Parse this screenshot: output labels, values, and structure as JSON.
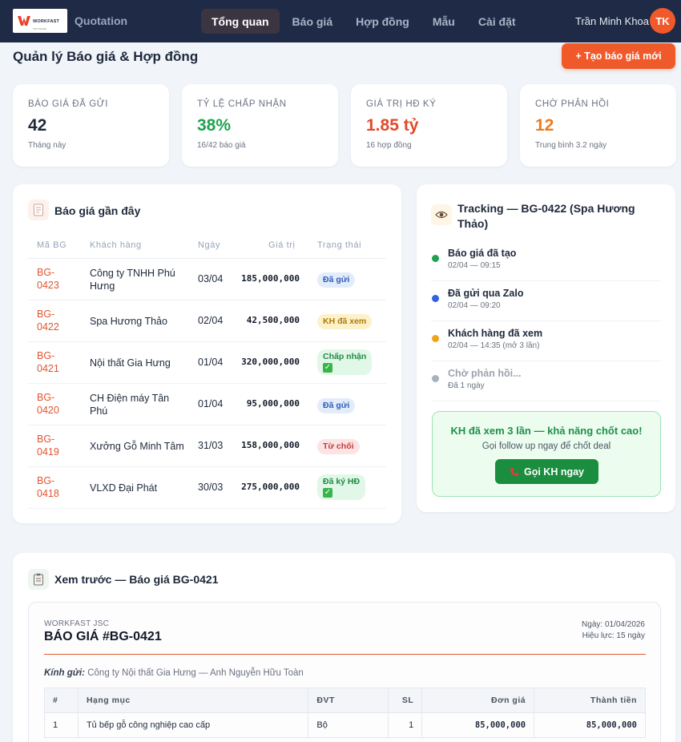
{
  "nav": {
    "logo_text": "WORKFAST",
    "logo_sub": "SOFTWARE",
    "app_title": "Quotation",
    "items": [
      "Tổng quan",
      "Báo giá",
      "Hợp đồng",
      "Mẫu",
      "Cài đặt"
    ],
    "user_name": "Trần Minh Khoa",
    "avatar_initials": "TK"
  },
  "header": {
    "title": "Quản lý Báo giá & Hợp đồng",
    "create_label": "+ Tạo báo giá mới"
  },
  "stats": [
    {
      "label": "Báo giá đã gửi",
      "value": "42",
      "sub": "Tháng này",
      "color": "#1e293b"
    },
    {
      "label": "Tỷ lệ chấp nhận",
      "value": "38%",
      "sub": "16/42 báo giá",
      "color": "#1ea24f"
    },
    {
      "label": "Giá trị HĐ ký",
      "value": "1.85 tỷ",
      "sub": "16 hợp đồng",
      "color": "#e04a2a"
    },
    {
      "label": "Chờ phản hồi",
      "value": "12",
      "sub": "Trung bình 3.2 ngày",
      "color": "#ef7a1a"
    }
  ],
  "recent": {
    "title": "Báo giá gần đây",
    "columns": [
      "Mã BG",
      "Khách hàng",
      "Ngày",
      "Giá trị",
      "Trạng thái"
    ],
    "rows": [
      {
        "id": "BG-0423",
        "customer": "Công ty TNHH Phú Hưng",
        "date": "03/04",
        "value": "185,000,000",
        "status": "Đã gửi",
        "kind": "sent"
      },
      {
        "id": "BG-0422",
        "customer": "Spa Hương Thảo",
        "date": "02/04",
        "value": "42,500,000",
        "status": "KH đã xem",
        "kind": "viewed"
      },
      {
        "id": "BG-0421",
        "customer": "Nội thất Gia Hưng",
        "date": "01/04",
        "value": "320,000,000",
        "status": "Chấp nhận",
        "kind": "accept"
      },
      {
        "id": "BG-0420",
        "customer": "CH Điện máy Tân Phú",
        "date": "01/04",
        "value": "95,000,000",
        "status": "Đã gửi",
        "kind": "sent"
      },
      {
        "id": "BG-0419",
        "customer": "Xưởng Gỗ Minh Tâm",
        "date": "31/03",
        "value": "158,000,000",
        "status": "Từ chối",
        "kind": "reject"
      },
      {
        "id": "BG-0418",
        "customer": "VLXD Đại Phát",
        "date": "30/03",
        "value": "275,000,000",
        "status": "Đã ký HĐ",
        "kind": "accept"
      }
    ]
  },
  "tracking": {
    "title": "Tracking — BG-0422 (Spa Hương Thảo)",
    "events": [
      {
        "title": "Báo giá đã tạo",
        "time": "02/04 — 09:15",
        "color": "#1ea24f",
        "muted": false
      },
      {
        "title": "Đã gửi qua Zalo",
        "time": "02/04 — 09:20",
        "color": "#2f63e0",
        "muted": false
      },
      {
        "title": "Khách hàng đã xem",
        "time": "02/04 — 14:35 (mở 3 lần)",
        "color": "#f0a21a",
        "muted": false
      },
      {
        "title": "Chờ phản hồi...",
        "time": "Đã 1 ngày",
        "color": "#a8b1c0",
        "muted": true
      }
    ],
    "hot_title": "KH đã xem 3 lần — khả năng chốt cao!",
    "hot_sub": "Gọi follow up ngay để chốt deal",
    "call_label": "Gọi KH ngay"
  },
  "preview": {
    "title": "Xem trước — Báo giá BG-0421",
    "company": "WORKFAST JSC",
    "doc_title": "BÁO GIÁ #BG-0421",
    "date_line": "Ngày: 01/04/2026",
    "valid_line": "Hiệu lực: 15 ngày",
    "to_label": "Kính gửi:",
    "to_value": "Công ty Nội thất Gia Hưng — Anh Nguyễn Hữu Toàn",
    "columns": [
      "#",
      "Hạng mục",
      "ĐVT",
      "SL",
      "Đơn giá",
      "Thành tiền"
    ],
    "rows": [
      {
        "no": "1",
        "item": "Tủ bếp gỗ công nghiệp cao cấp",
        "unit": "Bộ",
        "qty": "1",
        "price": "85,000,000",
        "total": "85,000,000"
      }
    ]
  }
}
